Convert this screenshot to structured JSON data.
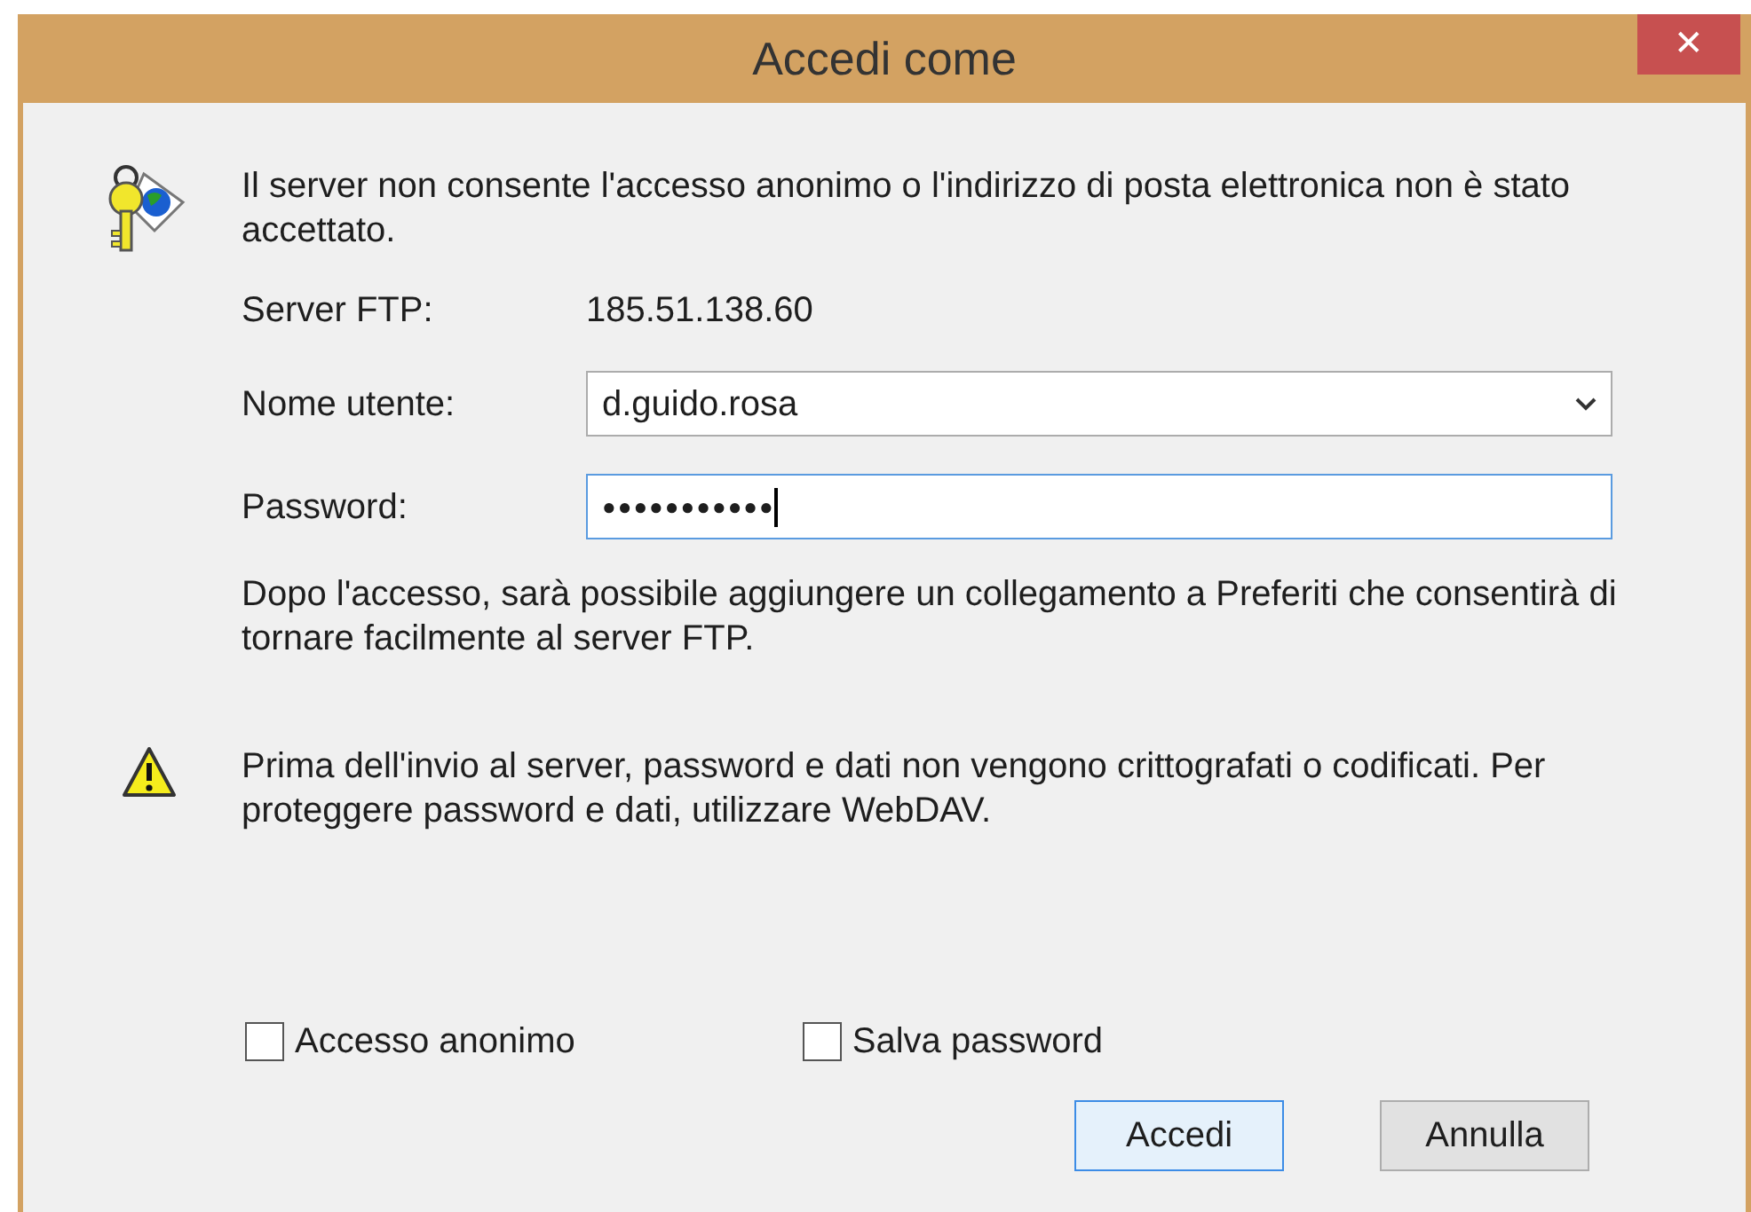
{
  "window": {
    "title": "Accedi come",
    "close": "✕"
  },
  "message": "Il server non consente l'accesso anonimo o l'indirizzo di posta elettronica non è stato accettato.",
  "server": {
    "label": "Server FTP:",
    "value": "185.51.138.60"
  },
  "username": {
    "label": "Nome utente:",
    "value": "d.guido.rosa"
  },
  "password": {
    "label": "Password:",
    "value": "●●●●●●●●●●●",
    "focused": true
  },
  "info": "Dopo l'accesso, sarà possibile aggiungere un collegamento a Preferiti che consentirà di tornare facilmente al server FTP.",
  "warning": "Prima dell'invio al server, password e dati non vengono crittografati o codificati. Per proteggere password e dati, utilizzare WebDAV.",
  "checkboxes": [
    {
      "label": "Accesso anonimo",
      "checked": false
    },
    {
      "label": "Salva password",
      "checked": false
    }
  ],
  "buttons": [
    {
      "label": "Accedi",
      "default": true
    },
    {
      "label": "Annulla",
      "default": false
    }
  ]
}
